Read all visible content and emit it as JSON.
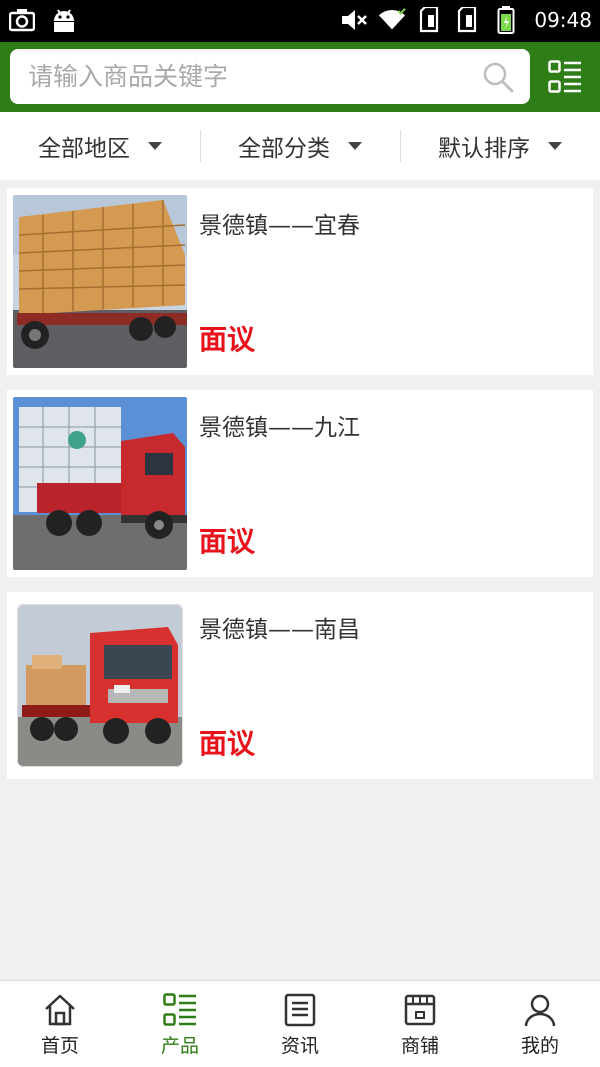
{
  "status_bar": {
    "left_icons": [
      "screenshot-icon",
      "android-icon"
    ],
    "right_icons": [
      "mute-icon",
      "wifi-icon",
      "sim1-icon",
      "sim2-icon",
      "battery-icon"
    ],
    "time": "09:48"
  },
  "header": {
    "search_placeholder": "请输入商品关键字",
    "search_icon": "search-icon",
    "menu_icon": "list-menu-icon",
    "brand_color": "#2e7d17"
  },
  "filters": [
    {
      "label": "全部地区"
    },
    {
      "label": "全部分类"
    },
    {
      "label": "默认排序"
    }
  ],
  "products": [
    {
      "title": "景德镇——宜春",
      "price": "面议"
    },
    {
      "title": "景德镇——九江",
      "price": "面议"
    },
    {
      "title": "景德镇——南昌",
      "price": "面议"
    }
  ],
  "nav": {
    "items": [
      {
        "label": "首页",
        "icon": "home-icon"
      },
      {
        "label": "产品",
        "icon": "product-grid-icon",
        "active": true
      },
      {
        "label": "资讯",
        "icon": "news-icon"
      },
      {
        "label": "商铺",
        "icon": "shop-icon"
      },
      {
        "label": "我的",
        "icon": "user-icon"
      }
    ]
  },
  "colors": {
    "price": "#e8121b",
    "accent": "#2e7d17"
  }
}
